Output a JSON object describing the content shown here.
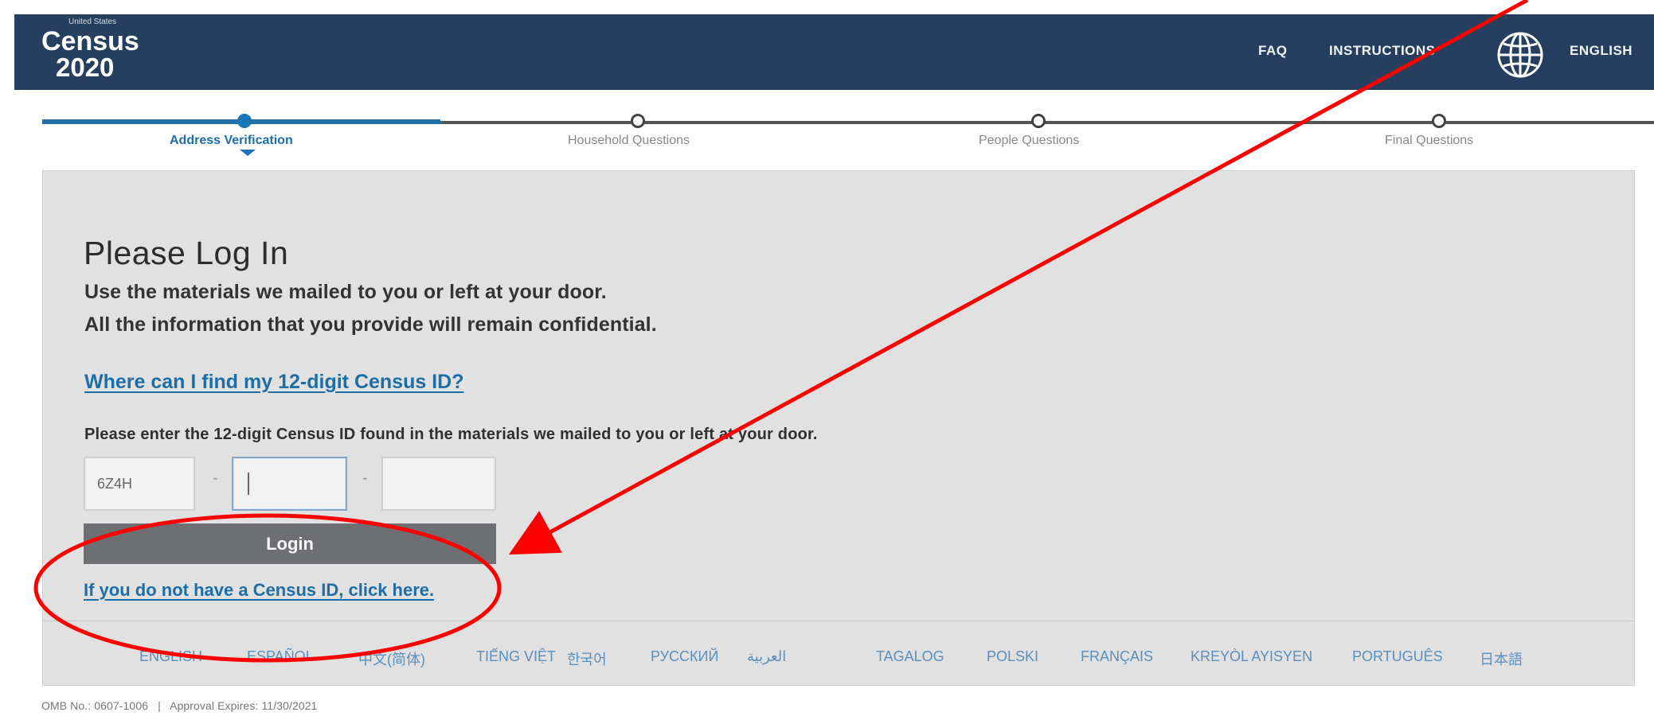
{
  "header": {
    "logo_small": "United States",
    "logo_word": "Census",
    "logo_year": "2020",
    "faq": "FAQ",
    "instructions": "INSTRUCTIONS",
    "english": "ENGLISH",
    "background_color": "#273f5f"
  },
  "progress": {
    "steps": [
      {
        "label": "Address Verification",
        "state": "current"
      },
      {
        "label": "Household Questions",
        "state": "upcoming"
      },
      {
        "label": "People Questions",
        "state": "upcoming"
      },
      {
        "label": "Final Questions",
        "state": "upcoming"
      }
    ],
    "active_color": "#1a74b8"
  },
  "login": {
    "title": "Please Log In",
    "lead_1": "Use the materials we mailed to you or left at your door.",
    "lead_2": "All the information that you provide will remain confidential.",
    "where_link": "Where can I find my 12-digit Census ID?",
    "instruction": "Please enter the 12-digit Census ID found in the materials we mailed to you or left at your door.",
    "field_1_value": "6Z4H",
    "field_2_value": "",
    "field_3_value": "",
    "separator": "-",
    "button": "Login",
    "no_id_link": "If you do not have a Census ID, click here."
  },
  "languages": [
    "ENGLISH",
    "ESPAÑOL",
    "中文(简体)",
    "TIẾNG VIỆT",
    "한국어",
    "РУССКИЙ",
    "العربية",
    "TAGALOG",
    "POLSKI",
    "FRANÇAIS",
    "KREYÒL AYISYEN",
    "PORTUGUÊS",
    "日本語"
  ],
  "footer": {
    "omb": "OMB No.: 0607-1006",
    "divider": "|",
    "approval": "Approval Expires: 11/30/2021"
  },
  "annotation": {
    "color": "#ff0000"
  }
}
